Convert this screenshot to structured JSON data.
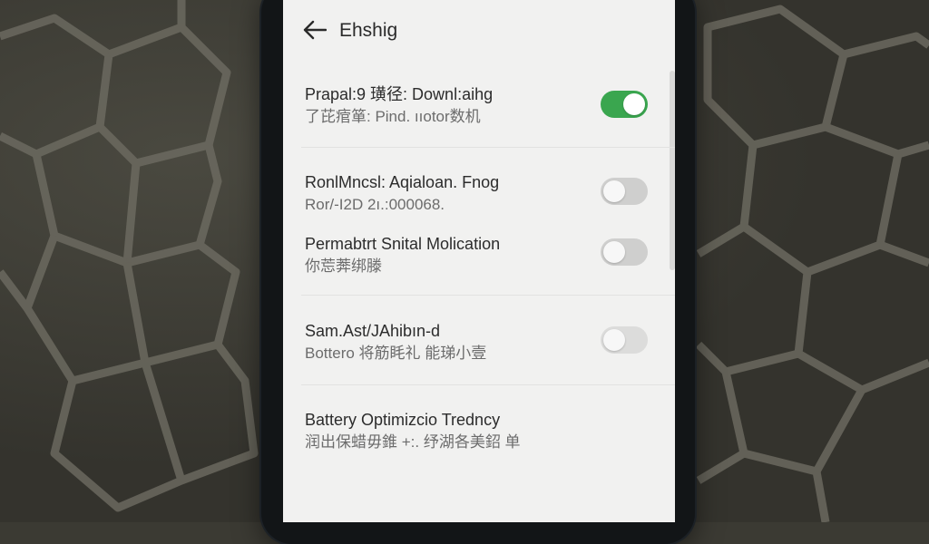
{
  "header": {
    "back_icon": "arrow-left-icon",
    "title": "Ehshig"
  },
  "settings": [
    {
      "label": "Prapal:9 璜径: Downl:aihg",
      "subtitle": "了芘痯箪: Pind. ııotor数机",
      "toggle_on": true
    },
    {
      "label": "RonlMncsl: Aqialoan. Fnog",
      "subtitle": "Ror/-I2D 2ı.:000068.",
      "toggle_on": false
    },
    {
      "label": "Permabtrt Snital Molication",
      "subtitle": "你莣莾绑滕",
      "toggle_on": false
    },
    {
      "label": "Sam.Ast/JAhibın-d",
      "subtitle": "Bottero 将筋眊礼 能珶小壹",
      "toggle_on": false
    },
    {
      "label": "Battery Optimizcio Tredncy",
      "subtitle": "润出保蜡毋錐 +:. 纾湖各美鉊 单"
    }
  ],
  "colors": {
    "toggle_on": "#3aa64f",
    "toggle_off": "#cfcfce",
    "screen_bg": "#f1f1f0"
  }
}
